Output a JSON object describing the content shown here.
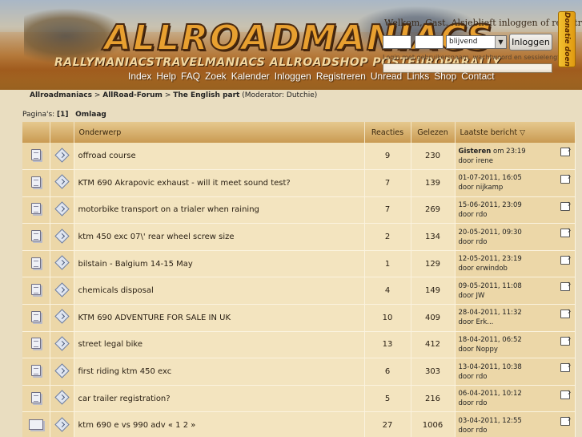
{
  "header": {
    "logo_text": "ALLROADMANIACS",
    "brands": "RALLYMANIACSTRAVELMANIACS ALLROADSHOP POSTEUROPARALLY",
    "welcome": "Welkom, Gast. Alsjeblieft inloggen of registreren.",
    "login_select_value": "blijvend",
    "login_button": "Inloggen",
    "login_note": "Login met gebruikersnaam, wachtwoord en sessielengte",
    "donate": "Donatie doen"
  },
  "nav": {
    "items": [
      "Index",
      "Help",
      "FAQ",
      "Zoek",
      "Kalender",
      "Inloggen",
      "Registreren",
      "Unread",
      "Links",
      "Shop",
      "Contact"
    ]
  },
  "breadcrumb": {
    "root": "Allroadmaniacs",
    "forum": "AllRoad-Forum",
    "board": "The English part",
    "moderator": "(Moderator: Dutchie)"
  },
  "pages": {
    "label": "Pagina's:",
    "current": "[1]",
    "bottom_link": "Omlaag"
  },
  "table": {
    "headers": {
      "subject": "Onderwerp",
      "replies": "Reacties",
      "views": "Gelezen",
      "last": "Laatste bericht"
    },
    "rows": [
      {
        "subject": "offroad course",
        "replies": "9",
        "views": "230",
        "date": "Gisteren",
        "date_suffix": " om 23:19",
        "by": "door irene"
      },
      {
        "subject": "KTM 690 Akrapovic exhaust - will it meet sound test?",
        "replies": "7",
        "views": "139",
        "date": "",
        "date_suffix": "01-07-2011, 16:05",
        "by": "door nijkamp"
      },
      {
        "subject": "motorbike transport on a trialer when raining",
        "replies": "7",
        "views": "269",
        "date": "",
        "date_suffix": "15-06-2011, 23:09",
        "by": "door rdo"
      },
      {
        "subject": "ktm 450 exc 07\\' rear wheel screw size",
        "replies": "2",
        "views": "134",
        "date": "",
        "date_suffix": "20-05-2011, 09:30",
        "by": "door rdo"
      },
      {
        "subject": "bilstain - Balgium 14-15 May",
        "replies": "1",
        "views": "129",
        "date": "",
        "date_suffix": "12-05-2011, 23:19",
        "by": "door erwindob"
      },
      {
        "subject": "chemicals disposal",
        "replies": "4",
        "views": "149",
        "date": "",
        "date_suffix": "09-05-2011, 11:08",
        "by": "door JW"
      },
      {
        "subject": "KTM 690 ADVENTURE FOR SALE IN UK",
        "replies": "10",
        "views": "409",
        "date": "",
        "date_suffix": "28-04-2011, 11:32",
        "by": "door Erk..."
      },
      {
        "subject": "street legal bike",
        "replies": "13",
        "views": "412",
        "date": "",
        "date_suffix": "18-04-2011, 06:52",
        "by": "door Noppy"
      },
      {
        "subject": "first riding ktm 450 exc",
        "replies": "6",
        "views": "303",
        "date": "",
        "date_suffix": "13-04-2011, 10:38",
        "by": "door rdo"
      },
      {
        "subject": "car trailer registration?",
        "replies": "5",
        "views": "216",
        "date": "",
        "date_suffix": "06-04-2011, 10:12",
        "by": "door rdo"
      },
      {
        "subject": "ktm 690 e vs 990 adv « 1 2 »",
        "replies": "27",
        "views": "1006",
        "date": "",
        "date_suffix": "03-04-2011, 12:55",
        "by": "door rdo"
      }
    ]
  },
  "icons": {
    "topic": "document-icon",
    "hot_topic": "hot-topic-icon",
    "message": "arrow-diamond-icon",
    "goto": "last-post-icon",
    "sort": "sort-down-icon"
  }
}
